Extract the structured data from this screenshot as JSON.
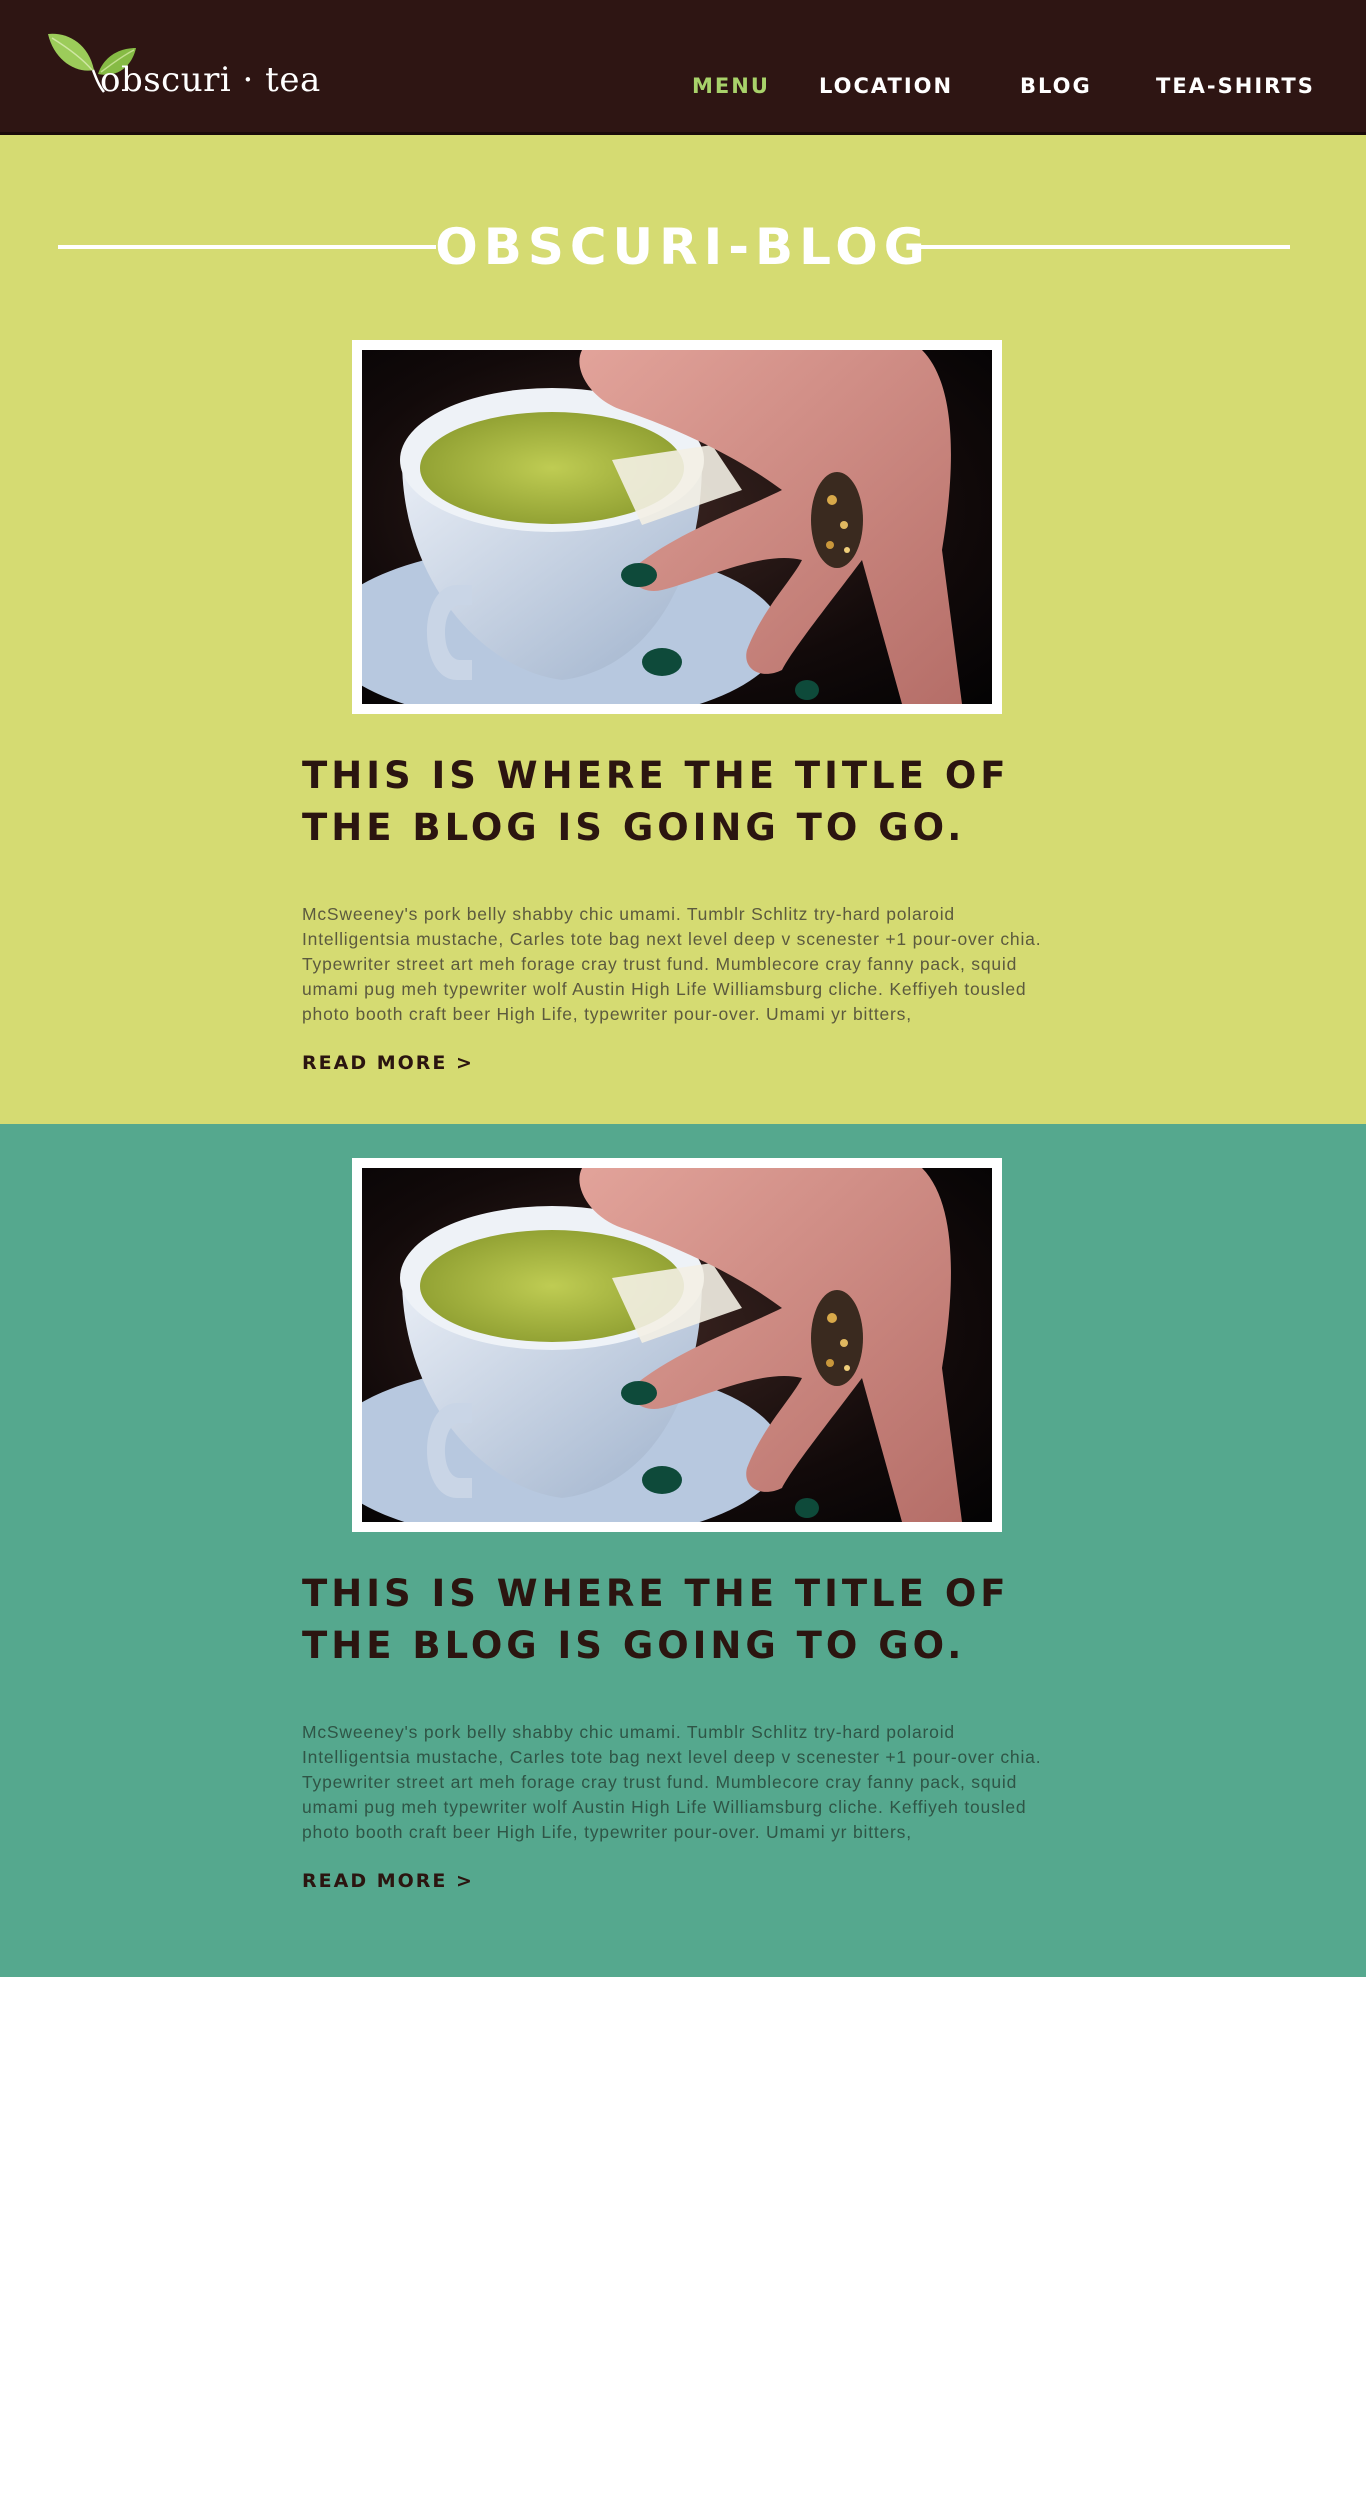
{
  "brand": {
    "name": "obscuri · tea",
    "logo_icon": "tea-leaf-icon"
  },
  "nav": {
    "items": [
      {
        "label": "MENU",
        "active": true
      },
      {
        "label": "LOCATION",
        "active": false
      },
      {
        "label": "BLOG",
        "active": false
      },
      {
        "label": "TEA-SHIRTS",
        "active": false
      }
    ]
  },
  "blog": {
    "heading": "OBSCURI-BLOG",
    "posts": [
      {
        "title": "THIS IS WHERE THE TITLE OF THE BLOG IS GOING TO GO.",
        "excerpt": "McSweeney's pork belly shabby chic umami. Tumblr Schlitz try-hard polaroid Intelligentsia mustache, Carles tote bag next level deep v scenester +1 pour-over chia. Typewriter street art meh forage cray trust fund. Mumblecore cray fanny pack, squid umami pug meh typewriter wolf Austin High Life Williamsburg cliche. Keffiyeh tousled photo booth craft beer High Life, typewriter pour-over. Umami yr bitters,",
        "read_more": "READ MORE >",
        "image_alt": "tea-cup-photo",
        "background": "#d5db72"
      },
      {
        "title": "THIS IS WHERE THE TITLE OF THE BLOG IS GOING TO GO.",
        "excerpt": "McSweeney's pork belly shabby chic umami. Tumblr Schlitz try-hard polaroid Intelligentsia mustache, Carles tote bag next level deep v scenester +1 pour-over chia. Typewriter street art meh forage cray trust fund. Mumblecore cray fanny pack, squid umami pug meh typewriter wolf Austin High Life Williamsburg cliche. Keffiyeh tousled photo booth craft beer High Life, typewriter pour-over. Umami yr bitters,",
        "read_more": "READ MORE >",
        "image_alt": "tea-cup-photo",
        "background": "#55a88e"
      }
    ]
  },
  "colors": {
    "header_bg": "#2e1513",
    "nav_active": "#a8d26a",
    "yellow_section": "#d5db72",
    "teal_section": "#55a88e",
    "title_text": "#2b1510"
  }
}
